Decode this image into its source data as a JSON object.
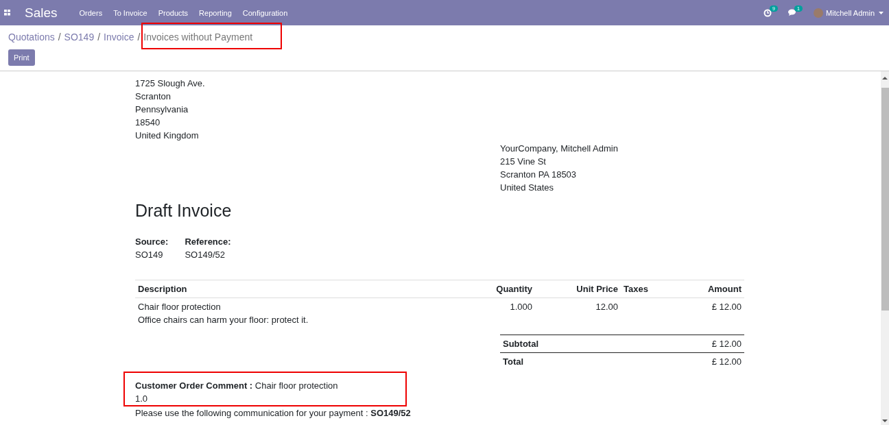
{
  "navbar": {
    "app": "Sales",
    "menu": [
      "Orders",
      "To Invoice",
      "Products",
      "Reporting",
      "Configuration"
    ],
    "activity_count": "9",
    "message_count": "1",
    "user": "Mitchell Admin"
  },
  "breadcrumb": {
    "items": [
      "Quotations",
      "SO149",
      "Invoice"
    ],
    "separator": "/",
    "current": "Invoices without Payment"
  },
  "buttons": [
    "Print"
  ],
  "document": {
    "company_address": [
      "1725 Slough Ave.",
      "Scranton",
      "Pennsylvania",
      "18540",
      "United Kingdom"
    ],
    "customer_address": [
      "YourCompany, Mitchell Admin",
      "215 Vine St",
      "Scranton PA 18503",
      "United States"
    ],
    "title": "Draft Invoice",
    "info": [
      {
        "label": "Source:",
        "value": "SO149"
      },
      {
        "label": "Reference:",
        "value": "SO149/52"
      }
    ],
    "columns": [
      "Description",
      "Quantity",
      "Unit Price",
      "Taxes",
      "Amount"
    ],
    "rows": [
      {
        "description": "Chair floor protection",
        "note": "Office chairs can harm your floor: protect it.",
        "quantity": "1.000",
        "unit_price": "12.00",
        "taxes": "",
        "amount": "£ 12.00"
      }
    ],
    "totals": [
      {
        "label": "Subtotal",
        "value": "£ 12.00"
      },
      {
        "label": "Total",
        "value": "£ 12.00"
      }
    ],
    "comment": {
      "label": "Customer Order Comment :",
      "value": "Chair floor protection",
      "extra": "1.0"
    },
    "payment_note": "Please use the following communication for your payment : **SO149/52**"
  }
}
